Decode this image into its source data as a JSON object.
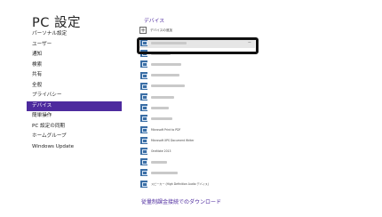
{
  "sidebar": {
    "title": "PC 設定",
    "items": [
      {
        "label": "パーソナル設定",
        "selected": false
      },
      {
        "label": "ユーザー",
        "selected": false
      },
      {
        "label": "通知",
        "selected": false
      },
      {
        "label": "検索",
        "selected": false
      },
      {
        "label": "共有",
        "selected": false
      },
      {
        "label": "全般",
        "selected": false
      },
      {
        "label": "プライバシー",
        "selected": false
      },
      {
        "label": "デバイス",
        "selected": true
      },
      {
        "label": "簡単操作",
        "selected": false
      },
      {
        "label": "PC 設定の同期",
        "selected": false
      },
      {
        "label": "ホームグループ",
        "selected": false
      },
      {
        "label": "Windows Update",
        "selected": false
      }
    ]
  },
  "main": {
    "section_title": "デバイス",
    "add_device_label": "デバイスの追加",
    "devices": [
      {
        "name": "",
        "selected": true,
        "icon": "display-icon"
      },
      {
        "name": "",
        "selected": false,
        "icon": "device-icon"
      },
      {
        "name": "",
        "selected": false,
        "icon": "device-icon"
      },
      {
        "name": "",
        "selected": false,
        "icon": "device-icon"
      },
      {
        "name": "",
        "selected": false,
        "icon": "device-icon"
      },
      {
        "name": "",
        "selected": false,
        "icon": "device-icon"
      },
      {
        "name": "",
        "selected": false,
        "icon": "device-icon"
      },
      {
        "name": "",
        "selected": false,
        "icon": "device-icon"
      },
      {
        "name": "Microsoft Print to PDF",
        "selected": false,
        "icon": "printer-icon"
      },
      {
        "name": "Microsoft XPS Document Writer",
        "selected": false,
        "icon": "printer-icon"
      },
      {
        "name": "OneNote 2013",
        "selected": false,
        "icon": "printer-icon"
      },
      {
        "name": "",
        "selected": false,
        "icon": "device-icon"
      },
      {
        "name": "",
        "selected": false,
        "icon": "device-icon"
      },
      {
        "name": "スピーカー (High Definition Audio デバイス)",
        "selected": false,
        "icon": "speaker-icon"
      }
    ],
    "download_title": "従量制課金接続でのダウンロード",
    "download_desc": ""
  },
  "colors": {
    "accent": "#4d2a9e",
    "device_icon": "#3a6ea5",
    "highlight_frame": "#111111"
  }
}
